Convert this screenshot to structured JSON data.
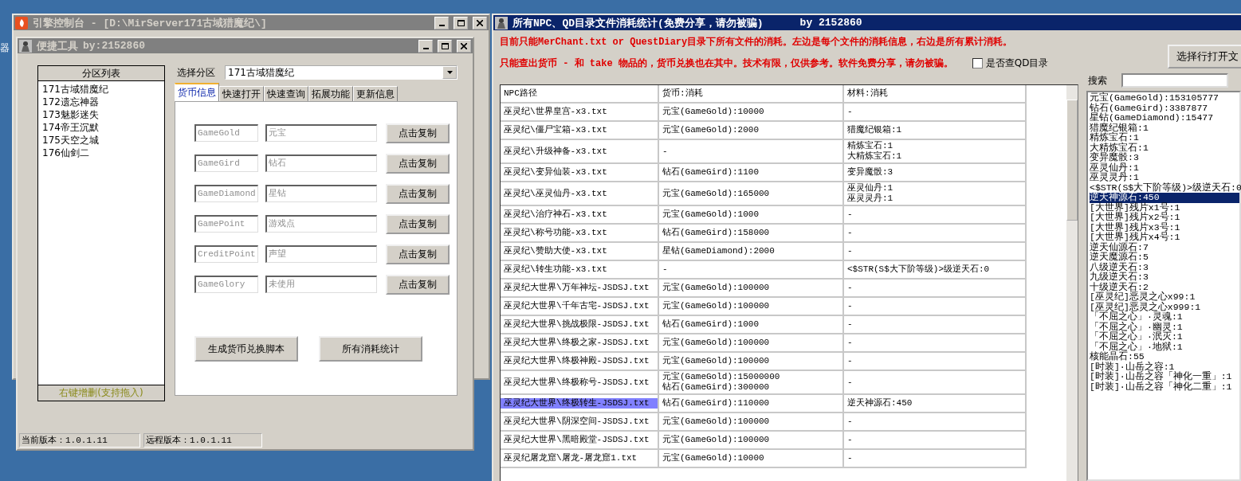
{
  "desktop": {
    "icon_label": "器"
  },
  "console_window": {
    "title": "引擎控制台 - [D:\\MirServer171古域猎魔纪\\]"
  },
  "tool_window": {
    "title": "便捷工具",
    "author": "by:2152860",
    "partition_list": {
      "header": "分区列表",
      "items": [
        "171古域猎魔纪",
        "172遗忘神器",
        "173魅影迷失",
        "174帝王沉默",
        "175天空之城",
        "176仙剑二"
      ],
      "footer": "右键增删(支持拖入)"
    },
    "partition_select": {
      "label": "选择分区",
      "value": "171古域猎魔纪"
    },
    "tabs": [
      {
        "label": "货币信息",
        "selected": true
      },
      {
        "label": "快速打开",
        "selected": false
      },
      {
        "label": "快速查询",
        "selected": false
      },
      {
        "label": "拓展功能",
        "selected": false
      },
      {
        "label": "更新信息",
        "selected": false
      }
    ],
    "currency_rows": [
      {
        "code": "GameGold",
        "name": "元宝",
        "button": "点击复制"
      },
      {
        "code": "GameGird",
        "name": "钻石",
        "button": "点击复制"
      },
      {
        "code": "GameDiamond",
        "name": "星钻",
        "button": "点击复制"
      },
      {
        "code": "GamePoint",
        "name": "游戏点",
        "button": "点击复制"
      },
      {
        "code": "CreditPoint",
        "name": "声望",
        "button": "点击复制"
      },
      {
        "code": "GameGlory",
        "name": "未使用",
        "button": "点击复制"
      }
    ],
    "actions": [
      "生成货币兑换脚本",
      "所有消耗统计"
    ],
    "status_bar": [
      "当前版本：1.0.1.11",
      "远程版本：1.0.1.11"
    ]
  },
  "stats_window": {
    "title": "所有NPC、QD目录文件消耗统计(免费分享，请勿被骗)",
    "author": "by 2152860",
    "notices": [
      "目前只能MerChant.txt or QuestDiary目录下所有文件的消耗。左边是每个文件的消耗信息，右边是所有累计消耗。",
      "只能查出货币 - 和 take 物品的，货币兑换也在其中。技术有限，仅供参考。软件免费分享，请勿被骗。"
    ],
    "qd_checkbox": {
      "label": "是否查QD目录",
      "checked": false
    },
    "open_button": "选择行打开文",
    "table": {
      "columns": [
        "NPC路径",
        "货币:消耗",
        "材料:消耗"
      ],
      "rows": [
        {
          "path": "巫灵纪\\世界皇宫-x3.txt",
          "currency": [
            "元宝(GameGold):10000"
          ],
          "materials": [
            "-"
          ],
          "selected": false
        },
        {
          "path": "巫灵纪\\僵尸宝箱-x3.txt",
          "currency": [
            "元宝(GameGold):2000"
          ],
          "materials": [
            "猎魔纪银箱:1"
          ],
          "selected": false
        },
        {
          "path": "巫灵纪\\升级神备-x3.txt",
          "currency": [
            "-"
          ],
          "materials": [
            "精炼宝石:1",
            "大精炼宝石:1"
          ],
          "selected": false
        },
        {
          "path": "巫灵纪\\变异仙装-x3.txt",
          "currency": [
            "钻石(GameGird):1100"
          ],
          "materials": [
            "变异魔骰:3"
          ],
          "selected": false
        },
        {
          "path": "巫灵纪\\巫灵仙丹-x3.txt",
          "currency": [
            "元宝(GameGold):165000"
          ],
          "materials": [
            "巫灵仙丹:1",
            "巫灵灵丹:1"
          ],
          "selected": false
        },
        {
          "path": "巫灵纪\\治疗神石-x3.txt",
          "currency": [
            "元宝(GameGold):1000"
          ],
          "materials": [
            "-"
          ],
          "selected": false
        },
        {
          "path": "巫灵纪\\称号功能-x3.txt",
          "currency": [
            "钻石(GameGird):158000"
          ],
          "materials": [
            "-"
          ],
          "selected": false
        },
        {
          "path": "巫灵纪\\赞助大使-x3.txt",
          "currency": [
            "星钻(GameDiamond):2000"
          ],
          "materials": [
            "-"
          ],
          "selected": false
        },
        {
          "path": "巫灵纪\\转生功能-x3.txt",
          "currency": [
            "-"
          ],
          "materials": [
            "<$STR(S$大下阶等级)>级逆天石:0"
          ],
          "selected": false
        },
        {
          "path": "巫灵纪大世界\\万年神坛-JSDSJ.txt",
          "currency": [
            "元宝(GameGold):100000"
          ],
          "materials": [
            "-"
          ],
          "selected": false
        },
        {
          "path": "巫灵纪大世界\\千年古宅-JSDSJ.txt",
          "currency": [
            "元宝(GameGold):100000"
          ],
          "materials": [
            "-"
          ],
          "selected": false
        },
        {
          "path": "巫灵纪大世界\\挑战极限-JSDSJ.txt",
          "currency": [
            "钻石(GameGird):1000"
          ],
          "materials": [
            "-"
          ],
          "selected": false
        },
        {
          "path": "巫灵纪大世界\\终极之家-JSDSJ.txt",
          "currency": [
            "元宝(GameGold):100000"
          ],
          "materials": [
            "-"
          ],
          "selected": false
        },
        {
          "path": "巫灵纪大世界\\终极神殿-JSDSJ.txt",
          "currency": [
            "元宝(GameGold):100000"
          ],
          "materials": [
            "-"
          ],
          "selected": false
        },
        {
          "path": "巫灵纪大世界\\终极称号-JSDSJ.txt",
          "currency": [
            "元宝(GameGold):15000000",
            "钻石(GameGird):300000"
          ],
          "materials": [
            "-"
          ],
          "selected": false
        },
        {
          "path": "巫灵纪大世界\\终极转生-JSDSJ.txt",
          "currency": [
            "钻石(GameGird):110000"
          ],
          "materials": [
            "逆天神源石:450"
          ],
          "selected": true
        },
        {
          "path": "巫灵纪大世界\\阴深空间-JSDSJ.txt",
          "currency": [
            "元宝(GameGold):100000"
          ],
          "materials": [
            "-"
          ],
          "selected": false
        },
        {
          "path": "巫灵纪大世界\\黑暗殿堂-JSDSJ.txt",
          "currency": [
            "元宝(GameGold):100000"
          ],
          "materials": [
            "-"
          ],
          "selected": false
        },
        {
          "path": "巫灵纪屠龙窟\\屠龙-屠龙窟1.txt",
          "currency": [
            "元宝(GameGold):10000"
          ],
          "materials": [
            "-"
          ],
          "selected": false
        }
      ]
    },
    "search": {
      "label": "搜索"
    },
    "totals": [
      {
        "text": "元宝(GameGold):153105777",
        "selected": false
      },
      {
        "text": "钻石(GameGird):3387877",
        "selected": false
      },
      {
        "text": "星钻(GameDiamond):15477",
        "selected": false
      },
      {
        "text": "猎魔纪银箱:1",
        "selected": false
      },
      {
        "text": "精炼宝石:1",
        "selected": false
      },
      {
        "text": "大精炼宝石:1",
        "selected": false
      },
      {
        "text": "变异魔骰:3",
        "selected": false
      },
      {
        "text": "巫灵仙丹:1",
        "selected": false
      },
      {
        "text": "巫灵灵丹:1",
        "selected": false
      },
      {
        "text": "<$STR(S$大下阶等级)>级逆天石:0",
        "selected": false
      },
      {
        "text": "逆天神源石:450",
        "selected": true
      },
      {
        "text": "[大世界]残片x1号:1",
        "selected": false
      },
      {
        "text": "[大世界]残片x2号:1",
        "selected": false
      },
      {
        "text": "[大世界]残片x3号:1",
        "selected": false
      },
      {
        "text": "[大世界]残片x4号:1",
        "selected": false
      },
      {
        "text": "逆天仙源石:7",
        "selected": false
      },
      {
        "text": "逆天魔源石:5",
        "selected": false
      },
      {
        "text": "八级逆天石:3",
        "selected": false
      },
      {
        "text": "九级逆天石:3",
        "selected": false
      },
      {
        "text": "十级逆天石:2",
        "selected": false
      },
      {
        "text": "[巫灵纪]恶灵之心x99:1",
        "selected": false
      },
      {
        "text": "[巫灵纪]恶灵之心x999:1",
        "selected": false
      },
      {
        "text": "「不屈之心」·灵魂:1",
        "selected": false
      },
      {
        "text": "「不屈之心」·幽灵:1",
        "selected": false
      },
      {
        "text": "「不屈之心」·泯灭:1",
        "selected": false
      },
      {
        "text": "「不屈之心」·地狱:1",
        "selected": false
      },
      {
        "text": "核能晶石:55",
        "selected": false
      },
      {
        "text": "[时装]·山岳之容:1",
        "selected": false
      },
      {
        "text": "[时装]·山岳之容「神化一重」:1",
        "selected": false
      },
      {
        "text": "[时装]·山岳之容「神化二重」:1",
        "selected": false
      }
    ]
  }
}
